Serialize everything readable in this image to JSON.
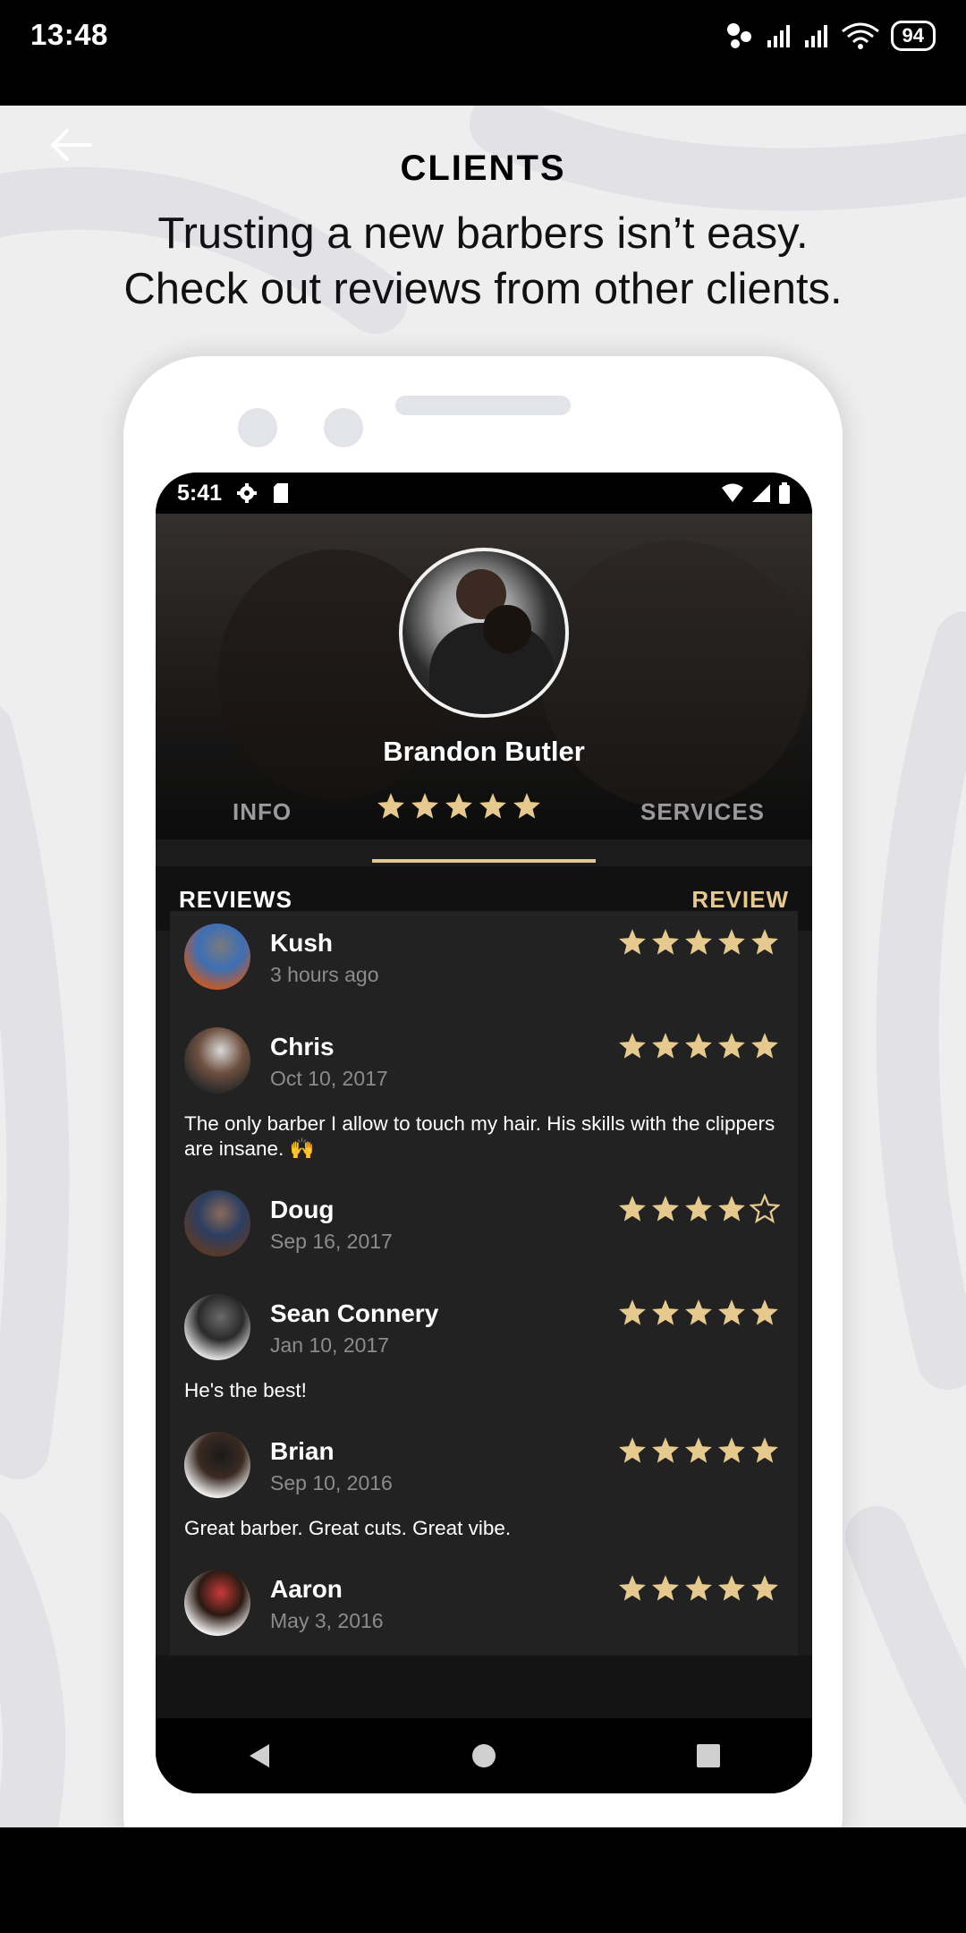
{
  "status_bar": {
    "time": "13:48",
    "battery": "94"
  },
  "header": {
    "title": "CLIENTS",
    "subtitle_line1": "Trusting a new barbers isn’t easy.",
    "subtitle_line2": "Check out reviews from other clients."
  },
  "inner_status": {
    "time": "5:41"
  },
  "profile": {
    "name": "Brandon Butler",
    "rating": 5
  },
  "tabs": {
    "info": "INFO",
    "services": "SERVICES"
  },
  "reviews_header": {
    "left": "REVIEWS",
    "right": "REVIEW"
  },
  "reviews": [
    {
      "name": "Kush",
      "date": "3 hours ago",
      "rating": 5,
      "text": ""
    },
    {
      "name": "Chris",
      "date": "Oct 10, 2017",
      "rating": 5,
      "text": "The only barber I allow to touch my hair. His skills with the clippers are insane. 🙌"
    },
    {
      "name": "Doug",
      "date": "Sep 16, 2017",
      "rating": 4,
      "text": ""
    },
    {
      "name": "Sean Connery",
      "date": "Jan 10, 2017",
      "rating": 5,
      "text": "He's the best!"
    },
    {
      "name": "Brian",
      "date": "Sep 10, 2016",
      "rating": 5,
      "text": "Great barber. Great cuts. Great vibe."
    },
    {
      "name": "Aaron",
      "date": "May 3, 2016",
      "rating": 5,
      "text": ""
    }
  ],
  "colors": {
    "gold": "#e6c98c",
    "list_bg": "#222222",
    "screen_bg": "#1b1b1b"
  },
  "icons": [
    "back-arrow-icon",
    "star-icon",
    "gear-icon",
    "sd-card-icon",
    "wifi-icon",
    "signal-icon",
    "battery-icon",
    "nav-back-icon",
    "nav-home-icon",
    "nav-recents-icon"
  ]
}
